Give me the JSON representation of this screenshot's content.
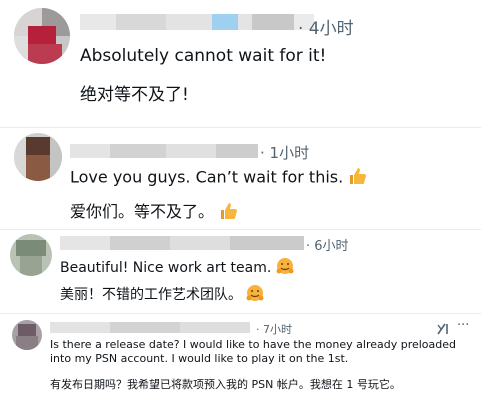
{
  "comments": [
    {
      "time": "· 4小时",
      "text": "Absolutely cannot wait for it!",
      "translation": "绝对等不及了!"
    },
    {
      "time": "· 1小时",
      "text": "Love you guys. Can’t wait for this.",
      "translation": "爱你们。等不及了。",
      "emoji": "thumbs-up-emoji"
    },
    {
      "time": "· 6小时",
      "text": "Beautiful! Nice work art team.",
      "translation": "美丽！不错的工作艺术团队。",
      "emoji": "hugging-face-emoji"
    },
    {
      "time": "· 7小时",
      "text": "Is there a release date? I would like to have the money already preloaded into my PSN account. I would like to play it on the 1st.",
      "translation": "有发布日期吗？我希望已将款项预入我的 PSN 帐户。我想在 1 号玩它。",
      "actions": [
        "grok-icon",
        "more-icon"
      ],
      "more_label": "···"
    }
  ],
  "colors": {
    "text": "#0f1419",
    "meta": "#536471",
    "separator": "#e6ecf0",
    "thumb": "#f6b73c",
    "hug": "#f7b23b"
  }
}
